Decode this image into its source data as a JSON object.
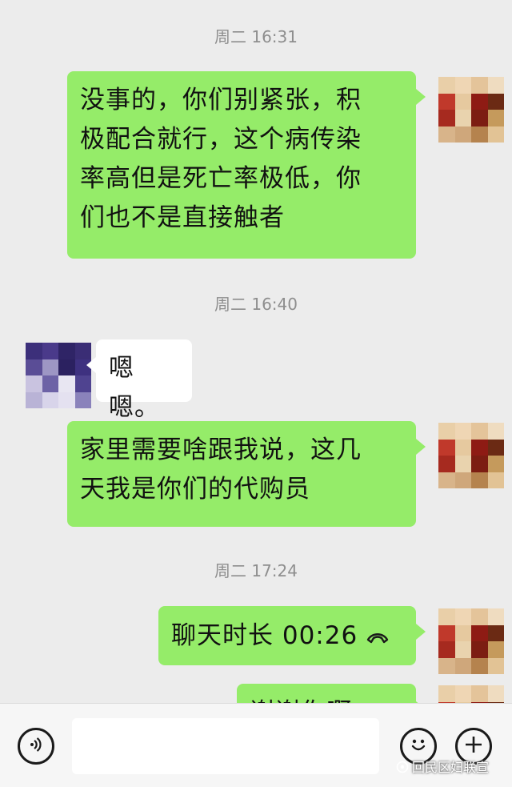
{
  "messages": [
    {
      "type": "time",
      "text": "周二 16:31"
    },
    {
      "type": "outgoing",
      "lines": [
        "没事的，你们别紧张，积",
        "极配合就行，这个病传染",
        "率高但是死亡率极低，你",
        "们也不是直接触者"
      ]
    },
    {
      "type": "time",
      "text": "周二 16:40"
    },
    {
      "type": "incoming",
      "lines": [
        "嗯嗯。"
      ]
    },
    {
      "type": "outgoing",
      "lines": [
        "家里需要啥跟我说，这几",
        "天我是你们的代购员"
      ]
    },
    {
      "type": "time",
      "text": "周二 17:24"
    },
    {
      "type": "outgoing-call",
      "text": "聊天时长 00:26",
      "icon": "phone-hangup-icon"
    },
    {
      "type": "outgoing-partial",
      "text": "谢谢你啊"
    }
  ],
  "input_bar": {
    "voice_icon": "voice-icon",
    "emoji_icon": "emoji-icon",
    "plus_icon": "plus-icon",
    "input_value": ""
  },
  "watermark": {
    "text": "回民区妇联宣"
  },
  "colors": {
    "background": "#ececec",
    "outgoing_bubble": "#95ec69",
    "incoming_bubble": "#ffffff",
    "timestamp": "#8e8e8e"
  }
}
